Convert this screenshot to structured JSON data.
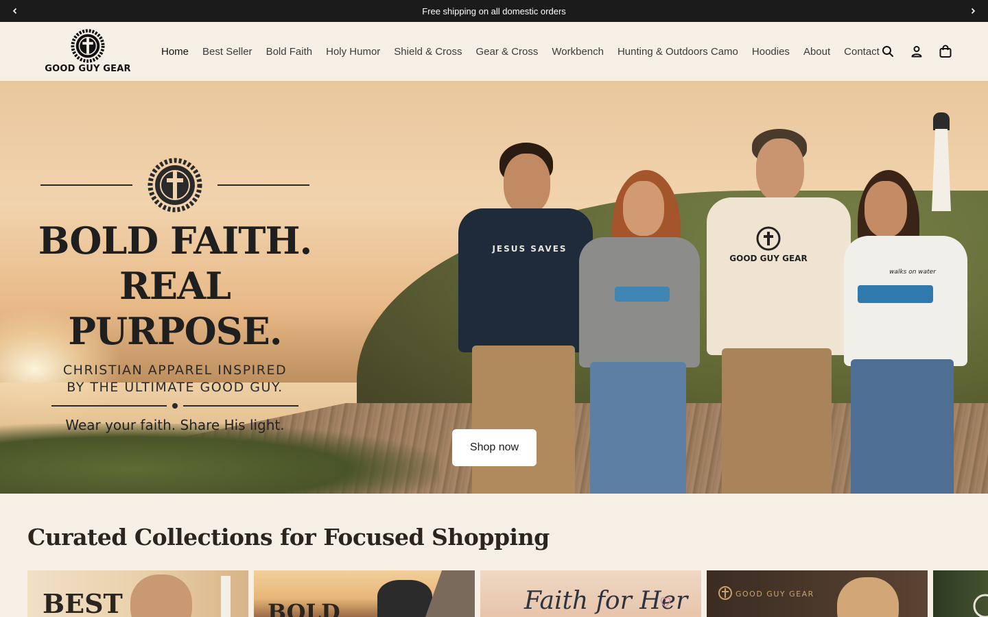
{
  "announcement": {
    "text": "Free shipping on all domestic orders",
    "prev_icon": "chevron-left-icon",
    "next_icon": "chevron-right-icon"
  },
  "header": {
    "logo_text": "GOOD GUY GEAR",
    "nav": [
      {
        "label": "Home",
        "active": true
      },
      {
        "label": "Best Seller"
      },
      {
        "label": "Bold Faith"
      },
      {
        "label": "Holy Humor"
      },
      {
        "label": "Shield & Cross"
      },
      {
        "label": "Gear & Cross"
      },
      {
        "label": "Workbench"
      },
      {
        "label": "Hunting & Outdoors Camo"
      },
      {
        "label": "Hoodies"
      },
      {
        "label": "About"
      },
      {
        "label": "Contact"
      }
    ],
    "icons": [
      "search-icon",
      "account-icon",
      "cart-icon"
    ]
  },
  "hero": {
    "headline_1": "BOLD FAITH.",
    "headline_2": "REAL PURPOSE.",
    "sub_1": "CHRISTIAN APPAREL INSPIRED",
    "sub_2": "BY THE ULTIMATE GOOD GUY.",
    "tagline": "Wear your faith. Share His light.",
    "shirt_1": "JESUS SAVES",
    "shirt_3": "GOOD GUY GEAR",
    "shirt_4": "walks on water",
    "cta": "Shop now"
  },
  "collections": {
    "title": "Curated Collections for Focused Shopping",
    "cards": [
      {
        "label": "BEST"
      },
      {
        "label": "BOLD"
      },
      {
        "label": "Faith for Her"
      },
      {
        "label": "GOOD GUY GEAR"
      },
      {
        "label": ""
      }
    ]
  },
  "colors": {
    "background": "#f6efe6",
    "announcement_bg": "#1b1b1b",
    "text": "#1b1b1b"
  }
}
